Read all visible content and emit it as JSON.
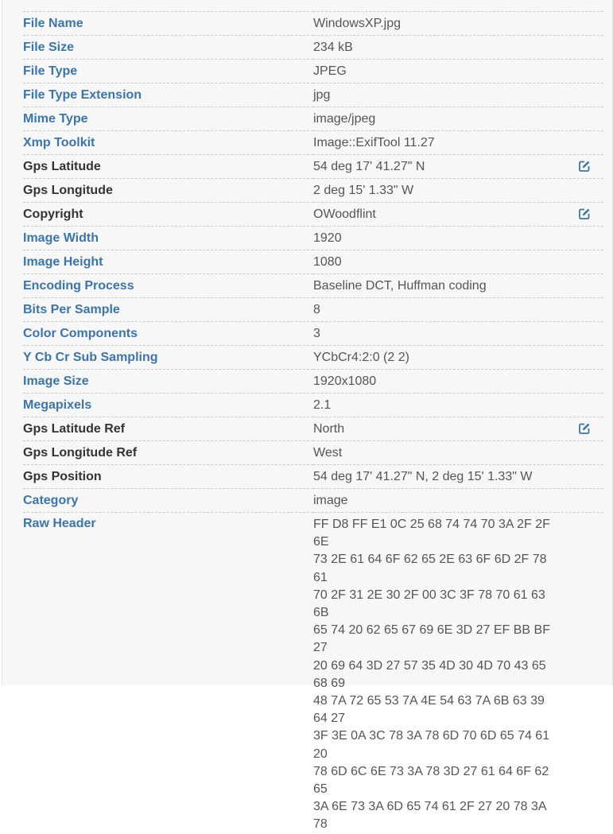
{
  "accent_color": "#3a75b0",
  "edit_icon": "edit-pencil-square-icon",
  "rows": [
    {
      "key": "File Name",
      "value": "WindowsXP.jpg",
      "editable": false,
      "style": "link"
    },
    {
      "key": "File Size",
      "value": "234 kB",
      "editable": false,
      "style": "link"
    },
    {
      "key": "File Type",
      "value": "JPEG",
      "editable": false,
      "style": "link"
    },
    {
      "key": "File Type Extension",
      "value": "jpg",
      "editable": false,
      "style": "link"
    },
    {
      "key": "Mime Type",
      "value": "image/jpeg",
      "editable": false,
      "style": "link"
    },
    {
      "key": "Xmp Toolkit",
      "value": "Image::ExifTool 11.27",
      "editable": false,
      "style": "link"
    },
    {
      "key": "Gps Latitude",
      "value": "54 deg 17' 41.27\" N",
      "editable": true,
      "style": "plain"
    },
    {
      "key": "Gps Longitude",
      "value": "2 deg 15' 1.33\" W",
      "editable": false,
      "style": "plain"
    },
    {
      "key": "Copyright",
      "value": "OWoodflint",
      "editable": true,
      "style": "plain"
    },
    {
      "key": "Image Width",
      "value": "1920",
      "editable": false,
      "style": "link"
    },
    {
      "key": "Image Height",
      "value": "1080",
      "editable": false,
      "style": "link"
    },
    {
      "key": "Encoding Process",
      "value": "Baseline DCT, Huffman coding",
      "editable": false,
      "style": "link"
    },
    {
      "key": "Bits Per Sample",
      "value": "8",
      "editable": false,
      "style": "link"
    },
    {
      "key": "Color Components",
      "value": "3",
      "editable": false,
      "style": "link"
    },
    {
      "key": "Y Cb Cr Sub Sampling",
      "value": "YCbCr4:2:0 (2 2)",
      "editable": false,
      "style": "link"
    },
    {
      "key": "Image Size",
      "value": "1920x1080",
      "editable": false,
      "style": "link"
    },
    {
      "key": "Megapixels",
      "value": "2.1",
      "editable": false,
      "style": "link"
    },
    {
      "key": "Gps Latitude Ref",
      "value": "North",
      "editable": true,
      "style": "plain"
    },
    {
      "key": "Gps Longitude Ref",
      "value": "West",
      "editable": false,
      "style": "plain"
    },
    {
      "key": "Gps Position",
      "value": "54 deg 17' 41.27\" N, 2 deg 15' 1.33\" W",
      "editable": false,
      "style": "plain"
    },
    {
      "key": "Category",
      "value": "image",
      "editable": false,
      "style": "link"
    }
  ],
  "raw_header": {
    "key": "Raw Header",
    "lines": [
      "FF D8 FF E1 0C 25 68 74 74 70 3A 2F 2F 6E",
      "73 2E 61 64 6F 62 65 2E 63 6F 6D 2F 78 61",
      "70 2F 31 2E 30 2F 00 3C 3F 78 70 61 63 6B",
      "65 74 20 62 65 67 69 6E 3D 27 EF BB BF 27",
      "20 69 64 3D 27 57 35 4D 30 4D 70 43 65 68 69",
      "48 7A 72 65 53 7A 4E 54 63 7A 6B 63 39 64 27",
      "3F 3E 0A 3C 78 3A 78 6D 70 6D 65 74 61 20",
      "78 6D 6C 6E 73 3A 78 3D 27 61 64 6F 62 65",
      "3A 6E 73 3A 6D 65 74 61 2F 27 20 78 3A 78"
    ]
  }
}
